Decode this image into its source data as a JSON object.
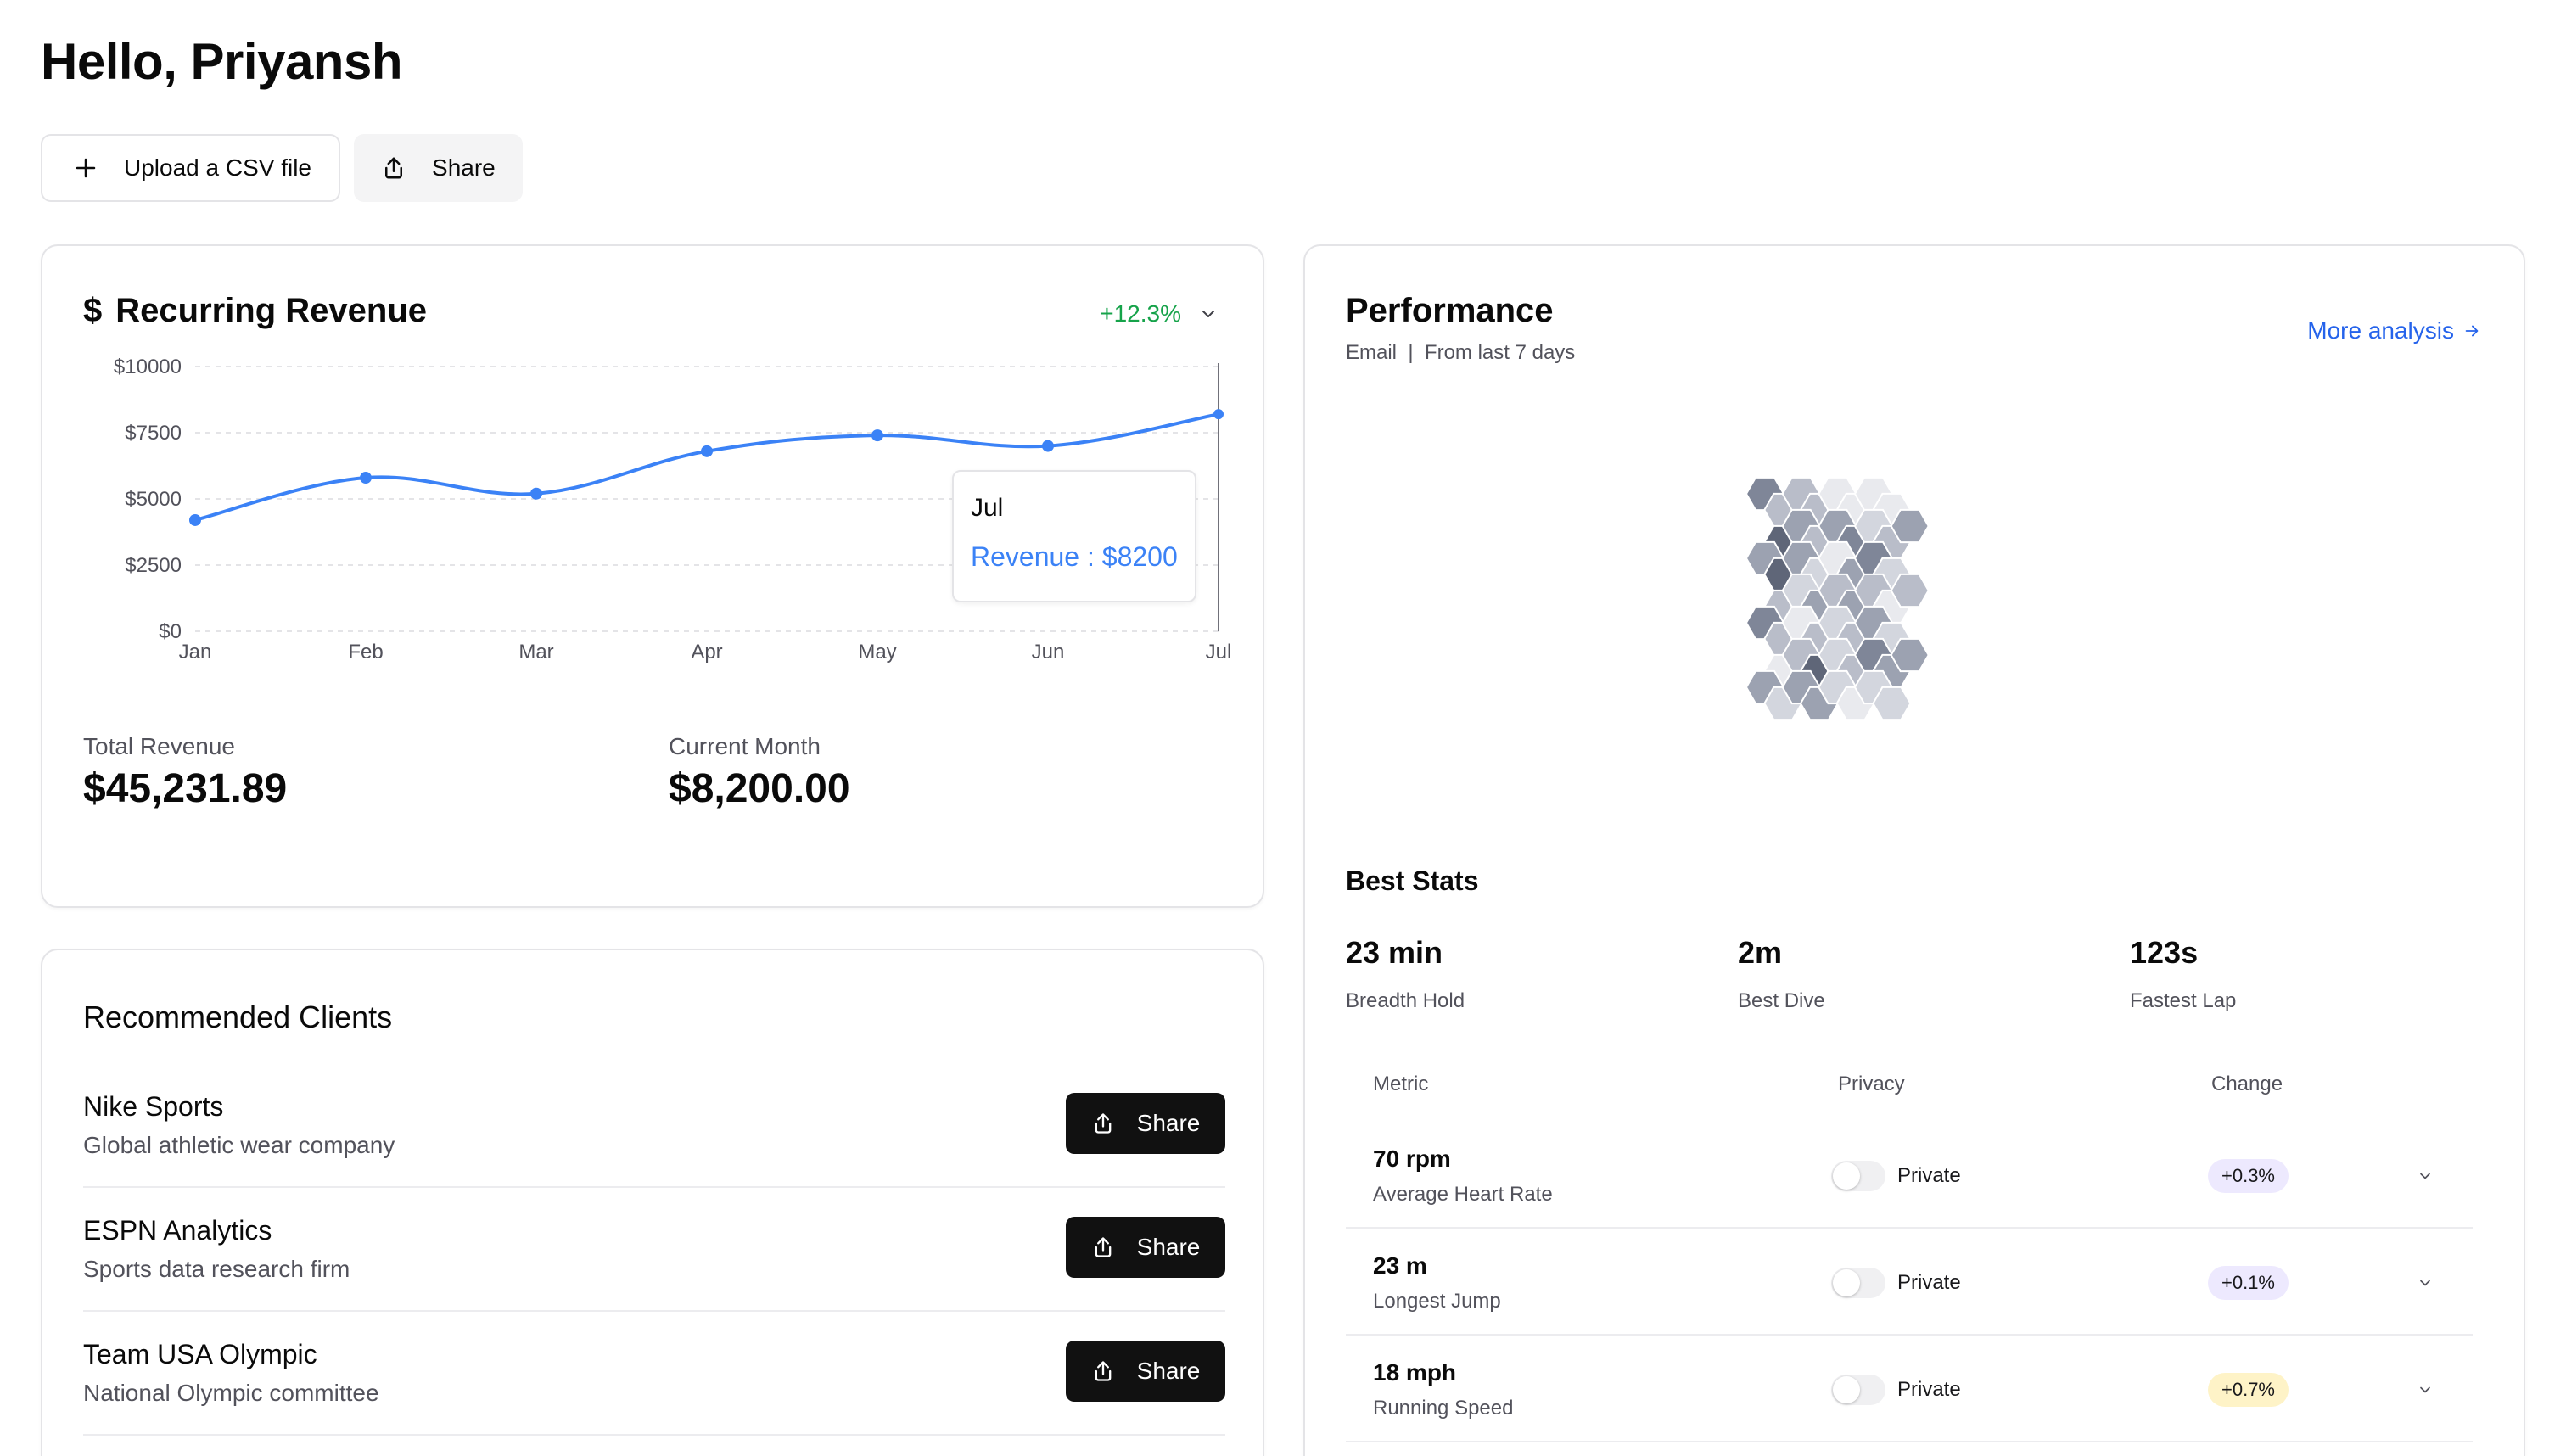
{
  "header": {
    "greeting": "Hello, Priyansh",
    "upload_label": "Upload a CSV file",
    "share_label": "Share"
  },
  "revenue": {
    "title": "Recurring Revenue",
    "currency_symbol": "$",
    "change": "+12.3%",
    "tooltip_label": "Jul",
    "tooltip_value": "Revenue : $8200",
    "total_label": "Total Revenue",
    "total_value": "$45,231.89",
    "month_label": "Current Month",
    "month_value": "$8,200.00",
    "colors": {
      "line": "#3b82f6",
      "positive": "#16a34a"
    }
  },
  "chart_data": {
    "type": "line",
    "categories": [
      "Jan",
      "Feb",
      "Mar",
      "Apr",
      "May",
      "Jun",
      "Jul"
    ],
    "series": [
      {
        "name": "Revenue",
        "values": [
          4200,
          5800,
          5200,
          6800,
          7400,
          7000,
          8200
        ]
      }
    ],
    "yticks": [
      "$10000",
      "$7500",
      "$5000",
      "$2500",
      "$0"
    ],
    "ylim": [
      0,
      10000
    ],
    "grid": true,
    "title": "",
    "xlabel": "",
    "ylabel": ""
  },
  "clients": {
    "title": "Recommended Clients",
    "share_label": "Share",
    "items": [
      {
        "name": "Nike Sports",
        "desc": "Global athletic wear company"
      },
      {
        "name": "ESPN Analytics",
        "desc": "Sports data research firm"
      },
      {
        "name": "Team USA Olympic",
        "desc": "National Olympic committee"
      }
    ]
  },
  "performance": {
    "title": "Performance",
    "subtitle": "Email  |  From last 7 days",
    "more_link": "More analysis",
    "heatmap_levels": [
      [
        4,
        2,
        2,
        2,
        0,
        0,
        0,
        0,
        -1
      ],
      [
        -1,
        5,
        3,
        2,
        3,
        4,
        1,
        2,
        3
      ],
      [
        3,
        5,
        3,
        1,
        0,
        3,
        4,
        1,
        -1
      ],
      [
        -1,
        2,
        1,
        3,
        2,
        3,
        2,
        0,
        2
      ],
      [
        4,
        2,
        0,
        2,
        1,
        2,
        3,
        1,
        -1
      ],
      [
        -1,
        0,
        2,
        5,
        1,
        2,
        4,
        3,
        3
      ],
      [
        3,
        1,
        3,
        3,
        1,
        0,
        1,
        1,
        -1
      ]
    ],
    "heatmap_colors": [
      "#e9eaee",
      "#d3d6de",
      "#b9bdc9",
      "#9ca2b1",
      "#7f8698",
      "#5f6678"
    ],
    "best_stats_title": "Best Stats",
    "best_stats": [
      {
        "value": "23 min",
        "label": "Breadth Hold"
      },
      {
        "value": "2m",
        "label": "Best Dive"
      },
      {
        "value": "123s",
        "label": "Fastest Lap"
      }
    ],
    "table_headers": {
      "metric": "Metric",
      "privacy": "Privacy",
      "change": "Change"
    },
    "metrics": [
      {
        "value": "70 rpm",
        "name": "Average Heart Rate",
        "privacy": "Private",
        "change": "+0.3%",
        "badge_color": "#ede9fe"
      },
      {
        "value": "23 m",
        "name": "Longest Jump",
        "privacy": "Private",
        "change": "+0.1%",
        "badge_color": "#ede9fe"
      },
      {
        "value": "18 mph",
        "name": "Running Speed",
        "privacy": "Private",
        "change": "+0.7%",
        "badge_color": "#fef3c7"
      }
    ]
  }
}
